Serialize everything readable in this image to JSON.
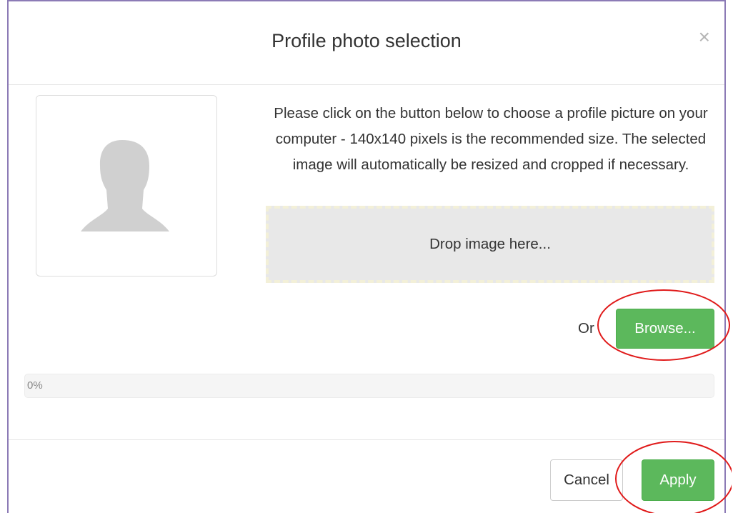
{
  "dialog": {
    "title": "Profile photo selection",
    "close_glyph": "×",
    "close_icon": "close-icon"
  },
  "avatar": {
    "icon": "user-silhouette-icon",
    "color": "#d0d0d0"
  },
  "instructions": {
    "text": "Please click on the button below to choose a profile picture on your computer - 140x140 pixels is the recommended size. The selected image will automatically be resized and cropped if necessary."
  },
  "dropzone": {
    "label": "Drop image here..."
  },
  "browse": {
    "or_label": "Or",
    "button_label": "Browse..."
  },
  "progress": {
    "label": "0%",
    "value": 0
  },
  "footer": {
    "cancel_label": "Cancel",
    "apply_label": "Apply"
  },
  "colors": {
    "primary_green": "#5cb85c",
    "dialog_border": "#8c7bb6",
    "annotation_red": "#e01a1a"
  }
}
